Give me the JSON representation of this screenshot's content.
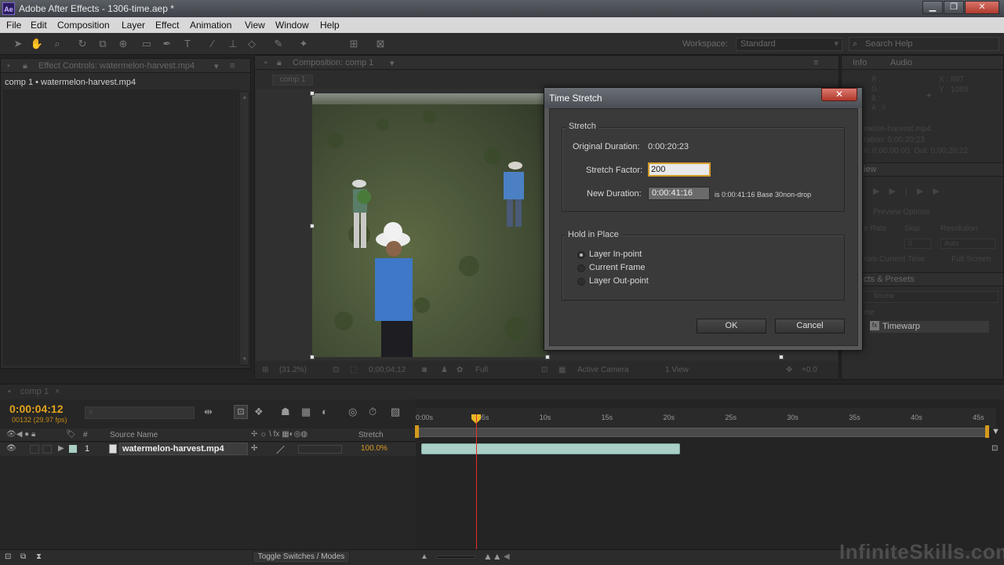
{
  "window": {
    "title": "Adobe After Effects - 1306-time.aep *",
    "app_icon": "Ae",
    "minimize": "▁",
    "maximize": "❐",
    "close": "✕"
  },
  "menu": [
    "File",
    "Edit",
    "Composition",
    "Layer",
    "Effect",
    "Animation",
    "View",
    "Window",
    "Help"
  ],
  "toolbar": {
    "workspace_label": "Workspace:",
    "workspace_value": "Standard",
    "search_placeholder": "Search Help"
  },
  "effect_controls": {
    "tab_label": "Effect Controls: watermelon-harvest.mp4",
    "layer_label": "comp 1 • watermelon-harvest.mp4"
  },
  "composition": {
    "tab_label": "Composition: comp 1",
    "subtab": "comp 1",
    "zoom": "(31.2%)",
    "timecode": "0;00;04;12",
    "resolution": "Full",
    "camera": "Active Camera",
    "views": "1 View",
    "exposure": "+0.0"
  },
  "right_panels": {
    "info_tab": "Info",
    "audio_tab": "Audio",
    "info_rgba": [
      "R :",
      "G :",
      "B :",
      "A : 0"
    ],
    "info_x": "X : 897",
    "info_y": "Y : 1089",
    "info_layer": "melon-harvest.mp4",
    "info_duration": "ration: 0;00;20;23",
    "info_inout": "n: 0;00;00;00, Out: 0;00;20;22",
    "preview_tab": "iew",
    "preview_options": "Preview Options",
    "frame_rate": "e Rate",
    "skip": "Skip",
    "resolution": "Resolution",
    "skip_val": "0",
    "res_val": "Auto",
    "from_current": "rom Current Time",
    "full_screen": "Full Screen",
    "effects_tab": "cts & Presets",
    "effects_search": "timew",
    "effects_category": "me",
    "effects_item": "Timewarp"
  },
  "dialog": {
    "title": "Time Stretch",
    "close": "✕",
    "stretch_group": "Stretch",
    "original_duration_label": "Original Duration:",
    "original_duration_value": "0:00:20:23",
    "stretch_factor_label": "Stretch Factor:",
    "stretch_factor_value": "200",
    "new_duration_label": "New Duration:",
    "new_duration_value": "0:00:41:16",
    "new_duration_info": "is 0:00:41:16  Base 30non-drop",
    "hold_group": "Hold in Place",
    "options": [
      {
        "label": "Layer In-point",
        "selected": true
      },
      {
        "label": "Current Frame",
        "selected": false
      },
      {
        "label": "Layer Out-point",
        "selected": false
      }
    ],
    "ok": "OK",
    "cancel": "Cancel"
  },
  "timeline": {
    "tab_label": "comp 1",
    "timecode": "0:00:04:12",
    "fps": "00132 (29.97 fps)",
    "col_source": "Source Name",
    "col_stretch": "Stretch",
    "col_hash": "#",
    "ruler": [
      "0:00s",
      "05s",
      "10s",
      "15s",
      "20s",
      "25s",
      "30s",
      "35s",
      "40s",
      "45s"
    ],
    "layer": {
      "number": "1",
      "name": "watermelon-harvest.mp4",
      "stretch": "100.0%"
    },
    "toggle_label": "Toggle Switches / Modes"
  },
  "watermark": "InfiniteSkills.com",
  "colors": {
    "timecode": "#e3a21a",
    "layer_bar": "#a9cfc6",
    "cti": "#e23030",
    "dialog_close": "#c04a3e"
  }
}
